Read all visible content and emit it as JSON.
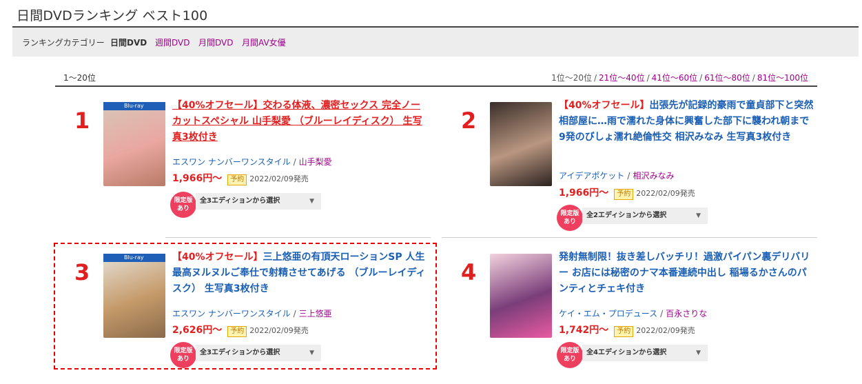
{
  "page": {
    "title": "日間DVDランキング ベスト100"
  },
  "categories": {
    "label": "ランキングカテゴリー",
    "items": [
      {
        "label": "日間DVD",
        "current": true
      },
      {
        "label": "週間DVD",
        "current": false
      },
      {
        "label": "月間DVD",
        "current": false
      },
      {
        "label": "月間AV女優",
        "current": false
      }
    ]
  },
  "range": {
    "current": "1〜20位",
    "pager": [
      "1位〜20位",
      "21位〜40位",
      "41位〜60位",
      "61位〜80位",
      "81位〜100位"
    ],
    "pager_separator": "/"
  },
  "items": [
    {
      "rank": "1",
      "sale": "【40%オフセール】",
      "title": "交わる体液、濃密セックス 完全ノーカットスペシャル 山手梨愛 （ブルーレイディスク） 生写真3枚付き",
      "label": "エスワン ナンバーワンスタイル",
      "actress": "山手梨愛",
      "price": "1,966円〜",
      "tag": "予約",
      "release": "2022/02/09発売",
      "badge": [
        "限定版",
        "あり"
      ],
      "edition": "全3エディションから選択",
      "cover_colors": [
        "#d8c6b8",
        "#e9a7a0",
        "#b87a66"
      ]
    },
    {
      "rank": "2",
      "sale": "【40%オフセール】",
      "title": "出張先が記録的豪雨で童貞部下と突然相部屋に…雨で濡れた身体に興奮した部下に襲われ朝まで9発のびしょ濡れ絶倫性交 相沢みなみ 生写真3枚付き",
      "label": "アイデアポケット",
      "actress": "相沢みなみ",
      "price": "1,966円〜",
      "tag": "予約",
      "release": "2022/02/09発売",
      "badge": [
        "限定版",
        "あり"
      ],
      "edition": "全2エディションから選択",
      "cover_colors": [
        "#3a2f2a",
        "#b99680",
        "#2b2220"
      ]
    },
    {
      "rank": "3",
      "sale": "【40%オフセール】",
      "title": "三上悠亜の有頂天ローションSP 人生最高ヌルヌルご奉仕で射精させてあげる （ブルーレイディスク） 生写真3枚付き",
      "label": "エスワン ナンバーワンスタイル",
      "actress": "三上悠亜",
      "price": "2,626円〜",
      "tag": "予約",
      "release": "2022/02/09発売",
      "badge": [
        "限定版",
        "あり"
      ],
      "edition": "全3エディションから選択",
      "cover_colors": [
        "#e6e0d6",
        "#c59a6a",
        "#8a6a4a"
      ]
    },
    {
      "rank": "4",
      "sale": "",
      "title": "発射無制限！抜き差しバッチリ！過激パイパン裏デリバリー お店には秘密のナマ本番連続中出し 稲場るかさんのパンティとチェキ付き",
      "label": "ケイ・エム・プロデュース",
      "actress": "百永さりな",
      "price": "1,742円〜",
      "tag": "予約",
      "release": "2022/02/09発売",
      "badge": [
        "限定版",
        "あり"
      ],
      "edition": "全4エディションから選択",
      "cover_colors": [
        "#f3d2de",
        "#7a3e7a",
        "#e95aa0"
      ]
    }
  ],
  "colors": {
    "accent_red": "#e02020",
    "link_blue": "#1a5fb4",
    "link_purple": "#a0008c",
    "highlight_border": "#e60000"
  }
}
